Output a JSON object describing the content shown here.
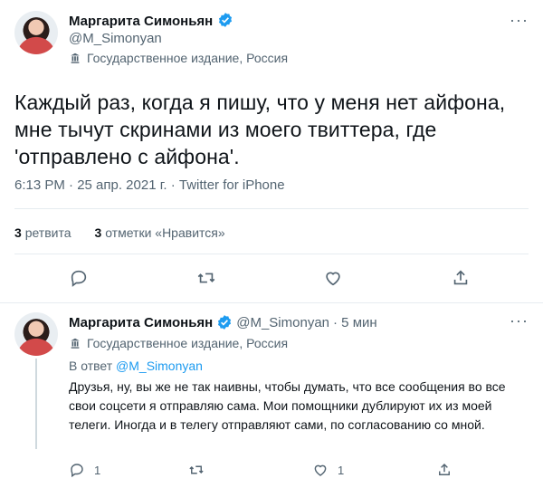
{
  "colors": {
    "accent": "#1d9bf0",
    "text": "#0f1419",
    "muted": "#536471",
    "divider": "#e6ecf0"
  },
  "main_tweet": {
    "author_name": "Маргарита Симоньян",
    "handle": "@M_Simonyan",
    "label": "Государственное издание, Россия",
    "text": "Каждый раз, когда я пишу, что у меня нет айфона, мне тычут скринами из моего твиттера, где 'отправлено с айфона'.",
    "timestamp": "6:13 PM · 25 апр. 2021 г. · Twitter for iPhone",
    "retweets_count": "3",
    "retweets_label": "ретвита",
    "likes_count": "3",
    "likes_label": "отметки «Нравится»"
  },
  "reply_tweet": {
    "author_name": "Маргарита Симоньян",
    "handle": "@M_Simonyan",
    "time_ago": "· 5 мин",
    "label": "Государственное издание, Россия",
    "reply_to_prefix": "В ответ",
    "reply_to_handle": "@M_Simonyan",
    "text": "Друзья, ну, вы же не так наивны, чтобы думать, что все сообщения во все свои соцсети я отправляю сама. Мои помощники дублируют их из моей телеги. Иногда и в телегу отправляют сами, по согласованию со мной.",
    "reply_count": "1",
    "like_count": "1"
  },
  "icons": {
    "verified": "verified-badge-icon",
    "gov_label": "government-flag-icon",
    "more": "more-horizontal-icon",
    "reply": "reply-icon",
    "retweet": "retweet-icon",
    "like": "heart-icon",
    "share": "share-icon"
  }
}
